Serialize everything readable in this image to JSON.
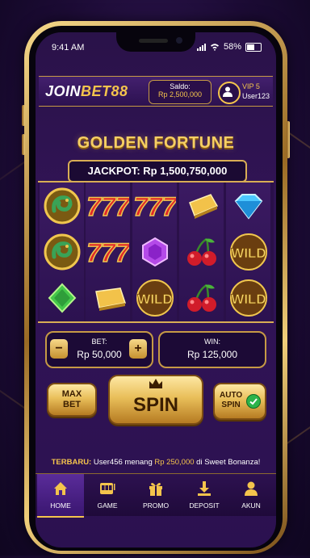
{
  "status_bar": {
    "time": "9:41 AM",
    "battery": "58%"
  },
  "header": {
    "logo_join": "JOIN",
    "logo_bet": "BET88",
    "saldo_label": "Saldo:",
    "saldo_value": "Rp 2,500,000",
    "vip_level": "VIP 5",
    "username": "User123"
  },
  "game": {
    "title": "GOLDEN FORTUNE",
    "jackpot": "JACKPOT: Rp 1,500,750,000",
    "reels": [
      [
        "dragon-symbol",
        "dragon-symbol",
        "green-gem-symbol"
      ],
      [
        "seven-symbol",
        "seven-symbol",
        "gold-bar-symbol"
      ],
      [
        "seven-symbol",
        "purple-gem-symbol",
        "wild-symbol"
      ],
      [
        "gold-bar-symbol",
        "cherry-symbol",
        "cherry-symbol"
      ],
      [
        "blue-gem-symbol",
        "wild-symbol",
        "wild-symbol"
      ]
    ]
  },
  "controls": {
    "bet_label": "BET:",
    "bet_value": "Rp 50,000",
    "win_label": "WIN:",
    "win_value": "Rp 125,000",
    "max_bet_line1": "MAX",
    "max_bet_line2": "BET",
    "spin_label": "SPIN",
    "auto_spin_line1": "AUTO",
    "auto_spin_line2": "SPIN",
    "minus": "−",
    "plus": "+"
  },
  "ticker": {
    "prefix": "TERBARU:",
    "pre_text": "User456 menang",
    "amount": "Rp 250,000",
    "post_text": "di Sweet Bonanza!"
  },
  "nav": [
    {
      "label": "HOME",
      "icon": "home-icon",
      "active": true
    },
    {
      "label": "GAME",
      "icon": "slot-machine-icon",
      "active": false
    },
    {
      "label": "PROMO",
      "icon": "gift-icon",
      "active": false
    },
    {
      "label": "DEPOSIT",
      "icon": "download-icon",
      "active": false
    },
    {
      "label": "AKUN",
      "icon": "user-icon",
      "active": false
    }
  ],
  "colors": {
    "gold": "#f4c44c",
    "purple_bg": "#2a1249",
    "accent_green": "#2cb34a"
  }
}
